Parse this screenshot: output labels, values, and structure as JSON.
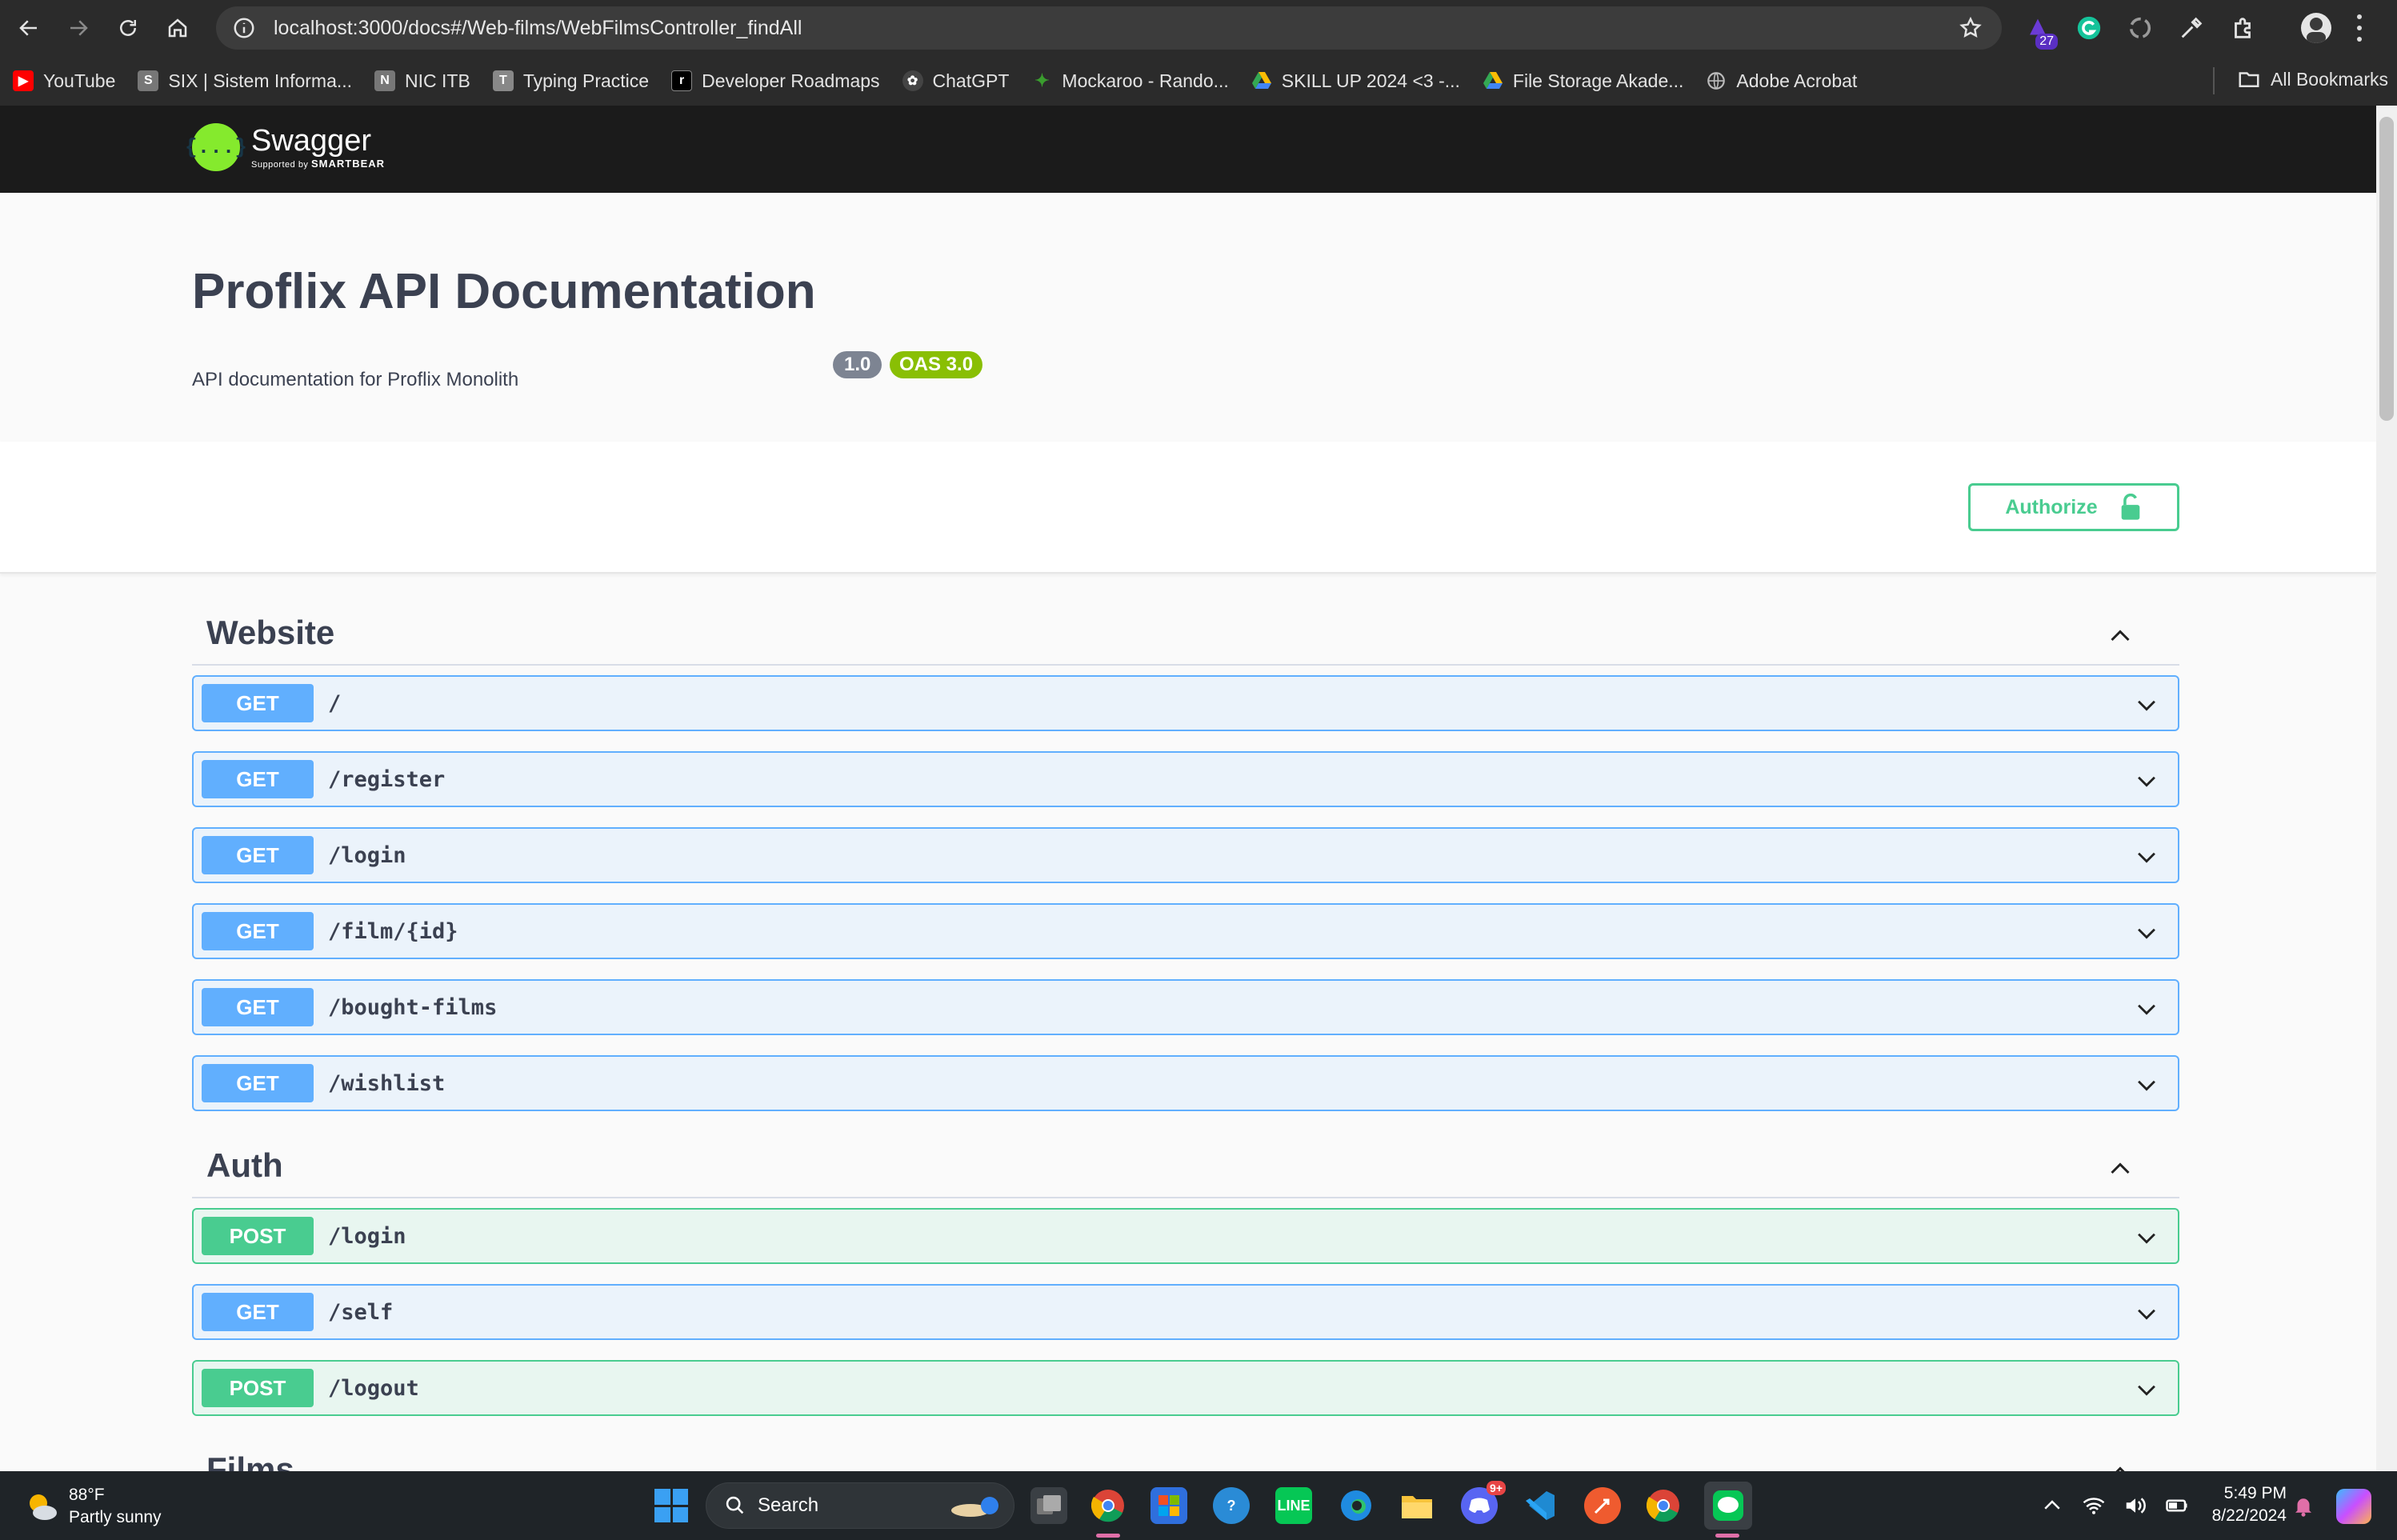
{
  "browser": {
    "url": "localhost:3000/docs#/Web-films/WebFilmsController_findAll",
    "extension_badge": "27",
    "bookmarks": [
      {
        "label": "YouTube",
        "icon": "youtube-icon",
        "color": "#ff0000"
      },
      {
        "label": "SIX | Sistem Informa...",
        "icon": "six-icon",
        "color": "#888888"
      },
      {
        "label": "NIC ITB",
        "icon": "nic-icon",
        "color": "#888888"
      },
      {
        "label": "Typing Practice",
        "icon": "keyboard-icon",
        "color": "#888888"
      },
      {
        "label": "Developer Roadmaps",
        "icon": "roadmap-icon",
        "color": "#000000"
      },
      {
        "label": "ChatGPT",
        "icon": "chatgpt-icon",
        "color": "#444444"
      },
      {
        "label": "Mockaroo - Rando...",
        "icon": "mockaroo-icon",
        "color": "#3a7d2e"
      },
      {
        "label": "SKILL UP 2024 <3 -...",
        "icon": "drive-icon",
        "color": "#4285f4"
      },
      {
        "label": "File Storage Akade...",
        "icon": "drive-icon",
        "color": "#4285f4"
      },
      {
        "label": "Adobe Acrobat",
        "icon": "globe-icon",
        "color": "#777777"
      }
    ],
    "all_bookmarks": "All Bookmarks"
  },
  "swagger": {
    "logo_mark": "{...}",
    "brand": "Swagger",
    "supported_by": "Supported by",
    "smartbear": "SMARTBEAR"
  },
  "info": {
    "title": "Proflix API Documentation",
    "version": "1.0",
    "oas": "OAS 3.0",
    "description": "API documentation for Proflix Monolith"
  },
  "authorize_label": "Authorize",
  "tags": [
    {
      "name": "Website",
      "operations": [
        {
          "method": "GET",
          "path": "/"
        },
        {
          "method": "GET",
          "path": "/register"
        },
        {
          "method": "GET",
          "path": "/login"
        },
        {
          "method": "GET",
          "path": "/film/{id}"
        },
        {
          "method": "GET",
          "path": "/bought-films"
        },
        {
          "method": "GET",
          "path": "/wishlist"
        }
      ]
    },
    {
      "name": "Auth",
      "operations": [
        {
          "method": "POST",
          "path": "/login"
        },
        {
          "method": "GET",
          "path": "/self"
        },
        {
          "method": "POST",
          "path": "/logout"
        }
      ]
    },
    {
      "name": "Films",
      "operations": []
    }
  ],
  "taskbar": {
    "temperature": "88°F",
    "weather": "Partly sunny",
    "search_label": "Search",
    "time": "5:49 PM",
    "date": "8/22/2024",
    "discord_badge": "9+"
  },
  "colors": {
    "get": "#61affe",
    "post": "#49cc90",
    "swagger_green": "#85ea2d"
  }
}
